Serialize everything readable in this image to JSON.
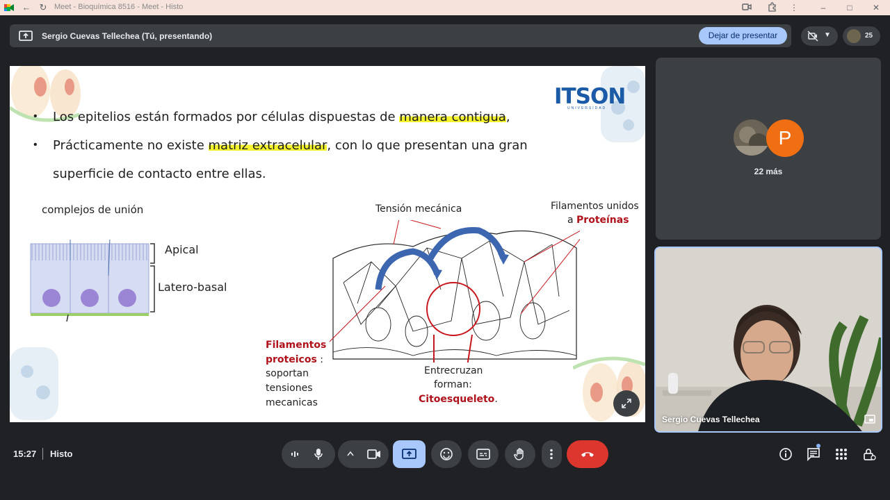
{
  "browser": {
    "tab_title": "Meet - Bioquímica 8516 - Meet - Histo"
  },
  "presenting_bar": {
    "text": "Sergio Cuevas Tellechea (Tú, presentando)",
    "stop_label": "Dejar de presentar",
    "participant_count": "25"
  },
  "slide": {
    "bullet1_pre": "Los epitelios están formados por células dispuestas de ",
    "bullet1_hl": "manera contigua",
    "bullet1_post": ",",
    "bullet2_pre": "Prácticamente no existe ",
    "bullet2_hl": "matriz extracelular",
    "bullet2_post": ", con lo que presentan una gran",
    "bullet2_cont": "superficie de contacto entre ellas.",
    "logo": "ITSON",
    "logo_sub": "UNIVERSIDAD",
    "label_complejos": "complejos de unión",
    "label_apical": "Apical",
    "label_latero": "Latero-basal",
    "label_tension": "Tensión mecánica",
    "label_filamentos_unidos": "Filamentos unidos",
    "label_a": "a ",
    "label_proteinas": "Proteínas",
    "label_filamentos": "Filamentos",
    "label_proteicos": "proteicos",
    "label_soportan_suffix": " :",
    "label_soportan": "soportan",
    "label_tensiones": "tensiones",
    "label_mecanicas": "mecanicas",
    "label_entrecruzan": "Entrecruzan",
    "label_forman": "forman:",
    "label_citoesqueleto": "Citoesqueleto",
    "label_period": "."
  },
  "participants": {
    "avatar_letter": "P",
    "more_label": "22 más"
  },
  "camera": {
    "name": "Sergio Cuevas Tellechea"
  },
  "bottom": {
    "time": "15:27",
    "meeting_name": "Histo"
  },
  "colors": {
    "present_active": "#a8c7fa",
    "end_call": "#dc362e",
    "highlight": "#f4f32e",
    "accent_red": "#b0121b",
    "logo_blue": "#1b5aa6"
  }
}
